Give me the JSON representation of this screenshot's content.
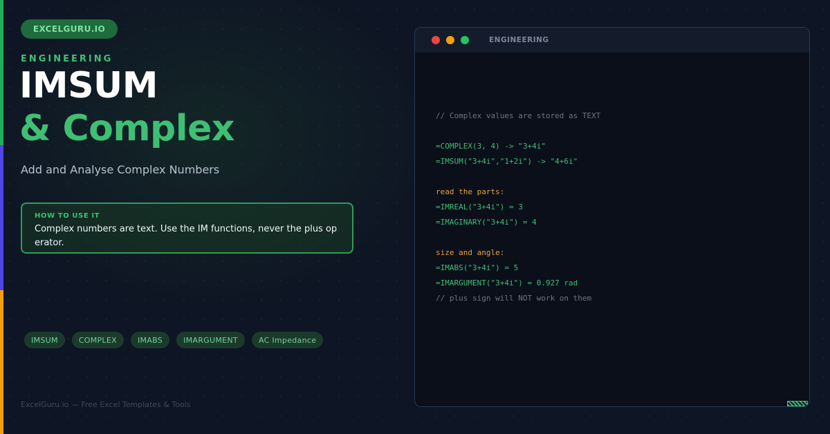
{
  "brand": "EXCELGURU.IO",
  "category": "ENGINEERING",
  "title_line1": "IMSUM",
  "title_line2": "& Complex",
  "subtitle": "Add and Analyse Complex Numbers",
  "tip": {
    "heading": "HOW TO USE IT",
    "text": "Complex numbers are text. Use the IM functions, never the plus operator."
  },
  "tags": [
    "IMSUM",
    "COMPLEX",
    "IMABS",
    "IMARGUMENT",
    "AC Impedance"
  ],
  "footer": "ExcelGuru.io — Free Excel Templates & Tools",
  "window": {
    "title": "ENGINEERING",
    "code": {
      "l1": "// Complex values are stored as TEXT",
      "l2": "",
      "l3": "=COMPLEX(3, 4) -> \"3+4i\"",
      "l4": "=IMSUM(\"3+4i\",\"1+2i\") -> \"4+6i\"",
      "l5": "",
      "l6": "read the parts:",
      "l7": "=IMREAL(\"3+4i\") = 3",
      "l8": "=IMAGINARY(\"3+4i\") = 4",
      "l9": "",
      "l10": "size and angle:",
      "l11": "=IMABS(\"3+4i\") = 5",
      "l12": "=IMARGUMENT(\"3+4i\") = 0.927 rad",
      "l13": "// plus sign will NOT work on them"
    }
  },
  "colors": {
    "accent_green": "#3fbf74",
    "accent_blue": "#4f46e5",
    "accent_orange": "#f59e0b",
    "background": "#0e1524"
  }
}
